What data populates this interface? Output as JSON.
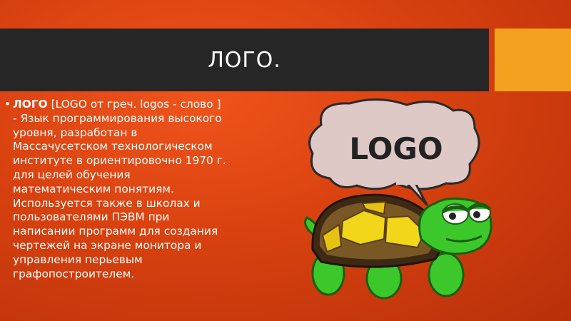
{
  "slide": {
    "title": "ЛОГО.",
    "bullet_symbol": "•",
    "term": "ЛОГО",
    "definition": " [LOGO от греч. logos - слово ] - Язык программирования высокого уровня, разработан в Массачусетском технологическом институте в ориентировочно 1970 г. для целей обучения математическим понятиям. Используется также в школах и пользователями ПЭВМ при написании программ для создания чертежей на экране монитора и управления перьевым графопостроителем."
  },
  "illustration": {
    "speech_text": "LOGO",
    "turtle_icon": "turtle-icon"
  },
  "colors": {
    "background": "#d8410f",
    "title_bar": "#262626",
    "accent": "#f4a11f",
    "text": "#ffffff"
  }
}
